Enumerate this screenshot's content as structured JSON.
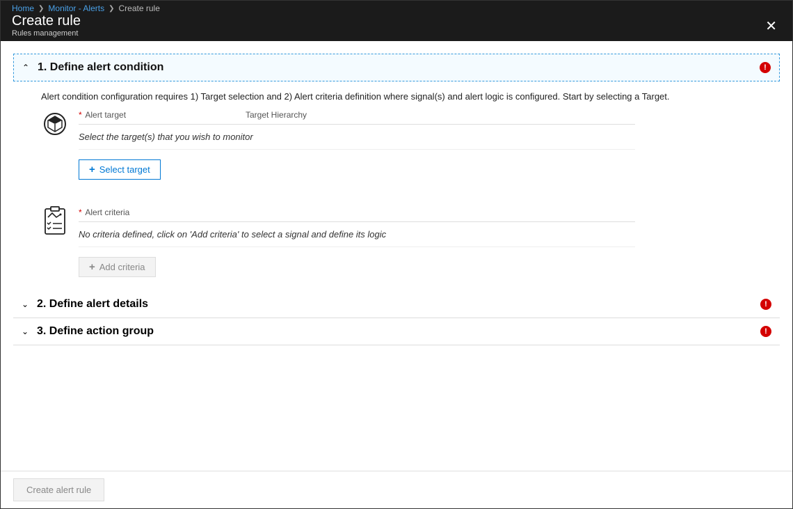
{
  "breadcrumb": {
    "home": "Home",
    "monitor": "Monitor - Alerts",
    "current": "Create rule"
  },
  "header": {
    "title": "Create rule",
    "subtitle": "Rules management"
  },
  "sections": {
    "s1": {
      "title": "1. Define alert condition",
      "description": "Alert condition configuration requires 1) Target selection and 2) Alert criteria definition where signal(s) and alert logic is configured. Start by selecting a Target.",
      "target_label": "Alert target",
      "hierarchy_label": "Target Hierarchy",
      "target_hint": "Select the target(s) that you wish to monitor",
      "select_target_btn": "Select target",
      "criteria_label": "Alert criteria",
      "criteria_hint": "No criteria defined, click on 'Add criteria' to select a signal and define its logic",
      "add_criteria_btn": "Add criteria"
    },
    "s2": {
      "title": "2. Define alert details"
    },
    "s3": {
      "title": "3. Define action group"
    }
  },
  "footer": {
    "create_btn": "Create alert rule"
  }
}
